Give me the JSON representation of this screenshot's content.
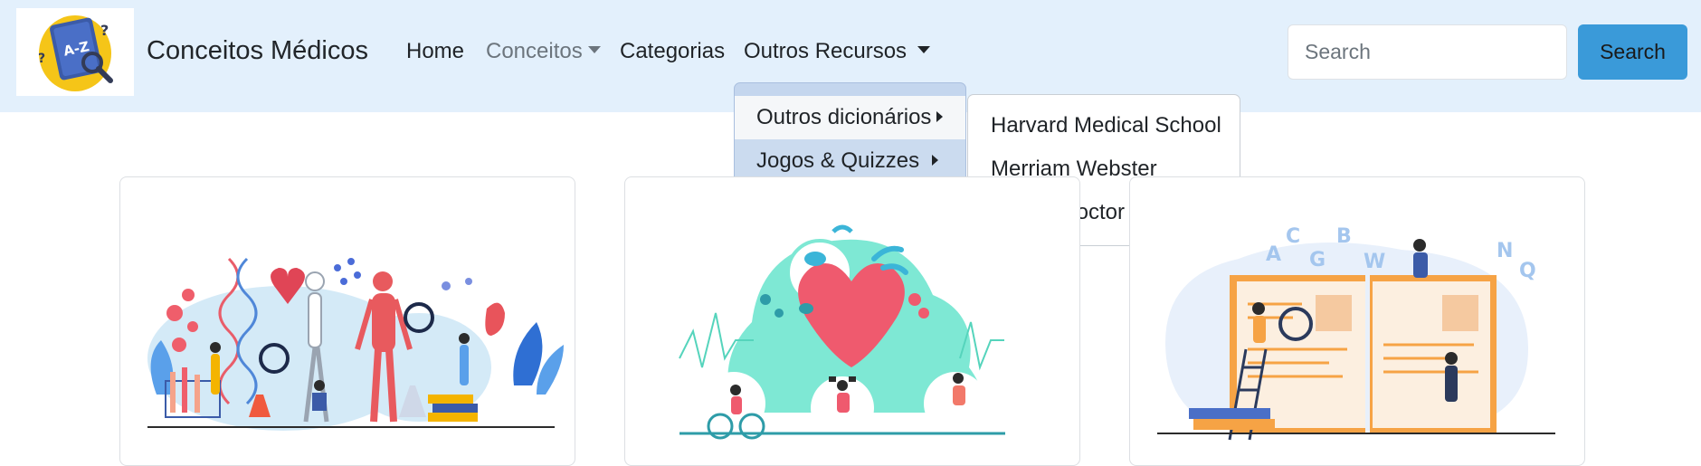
{
  "brand": {
    "title": "Conceitos Médicos",
    "logo_text": "A-Z"
  },
  "nav": {
    "home": "Home",
    "conceitos": "Conceitos",
    "categorias": "Categorias",
    "outros_recursos": "Outros Recursos"
  },
  "search": {
    "placeholder": "Search",
    "button": "Search"
  },
  "dropdown": {
    "items": [
      "Outros dicionários",
      "Jogos & Quizzes"
    ],
    "submenu": [
      "Harvard Medical School",
      "Merriam Webster",
      "Family Doctor"
    ]
  },
  "cards": [
    {
      "illustration": "human-anatomy-science-illustration"
    },
    {
      "illustration": "heart-fitness-health-illustration"
    },
    {
      "illustration": "dictionary-book-learning-illustration",
      "letters": [
        "A",
        "C",
        "G",
        "B",
        "W",
        "N",
        "Q"
      ]
    }
  ],
  "colors": {
    "navbar": "#e3f0fc",
    "accent": "#3a9ad9",
    "dropdown_active": "#c4d6ee"
  }
}
